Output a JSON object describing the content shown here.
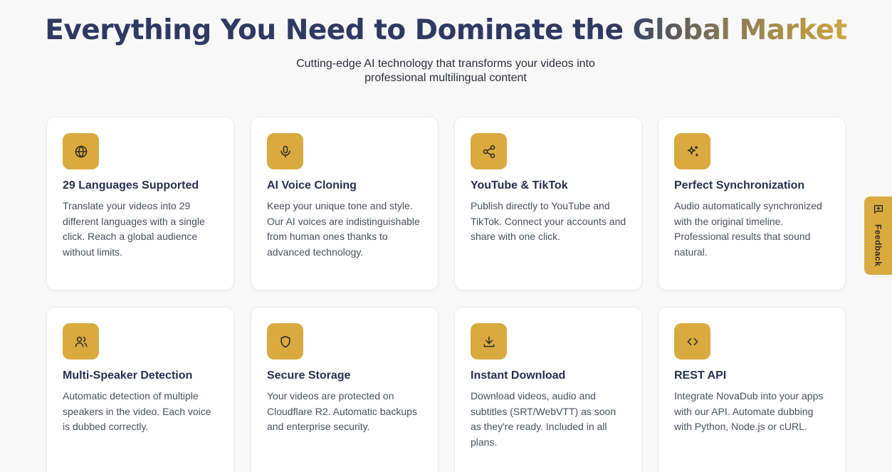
{
  "section": {
    "title_plain": "Everything You Need to Dominate the ",
    "title_highlight": "Global Market",
    "subtitle_line1": "Cutting-edge AI technology that transforms your videos into",
    "subtitle_line2": "professional multilingual content"
  },
  "features": [
    {
      "icon": "globe-icon",
      "title": "29 Languages Supported",
      "description": "Translate your videos into 29 different languages with a single click. Reach a global audience without limits."
    },
    {
      "icon": "microphone-icon",
      "title": "AI Voice Cloning",
      "description": "Keep your unique tone and style. Our AI voices are indistinguishable from human ones thanks to advanced technology."
    },
    {
      "icon": "share-icon",
      "title": "YouTube & TikTok",
      "description": "Publish directly to YouTube and TikTok. Connect your accounts and share with one click."
    },
    {
      "icon": "sparkles-icon",
      "title": "Perfect Synchronization",
      "description": "Audio automatically synchronized with the original timeline. Professional results that sound natural."
    },
    {
      "icon": "users-icon",
      "title": "Multi-Speaker Detection",
      "description": "Automatic detection of multiple speakers in the video. Each voice is dubbed correctly."
    },
    {
      "icon": "shield-icon",
      "title": "Secure Storage",
      "description": "Your videos are protected on Cloudflare R2. Automatic backups and enterprise security."
    },
    {
      "icon": "download-icon",
      "title": "Instant Download",
      "description": "Download videos, audio and subtitles (SRT/WebVTT) as soon as they're ready. Included in all plans."
    },
    {
      "icon": "code-icon",
      "title": "REST API",
      "description": "Integrate NovaDub into your apps with our API. Automate dubbing with Python, Node.js or cURL."
    }
  ],
  "feedback": {
    "label": "Feedback",
    "icon": "message-plus-icon"
  },
  "colors": {
    "accent": "#d9aa3f",
    "heading": "#2f3a63",
    "text": "#4a4f5c"
  }
}
